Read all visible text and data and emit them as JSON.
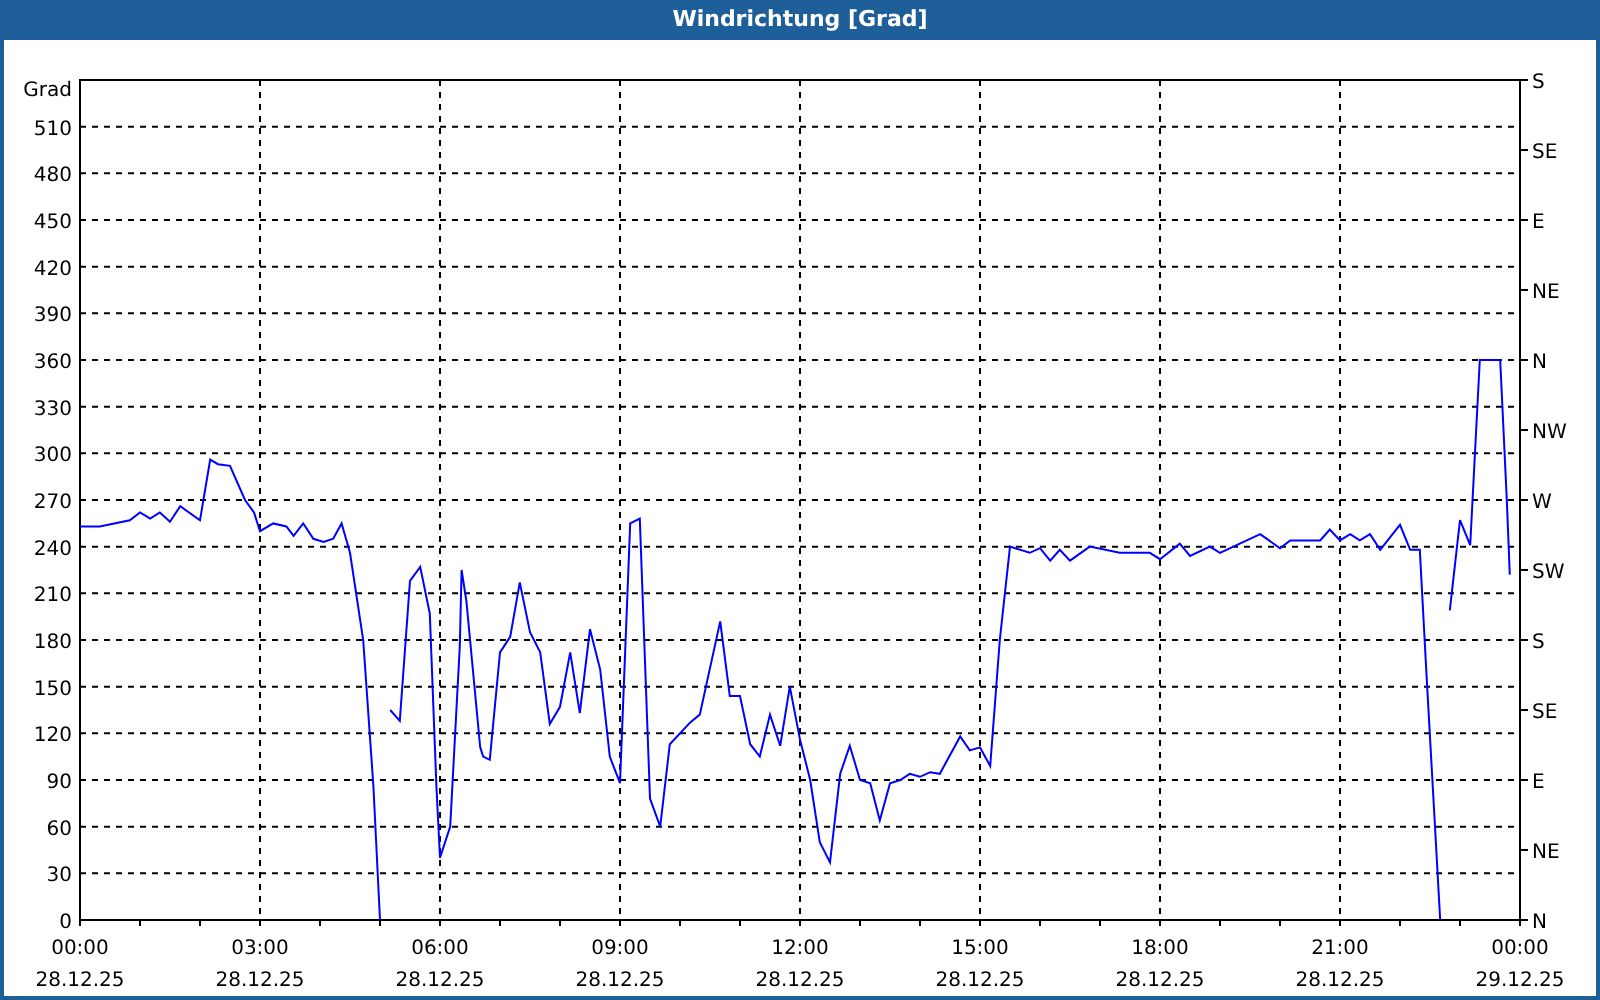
{
  "window": {
    "title": "Windrichtung [Grad]"
  },
  "chart_data": {
    "type": "line",
    "ylabel": "Grad",
    "xlim": [
      0,
      24
    ],
    "ylim": [
      0,
      540
    ],
    "grid": true,
    "x": [
      0,
      0.33,
      0.83,
      1.0,
      1.17,
      1.33,
      1.5,
      1.67,
      2.0,
      2.17,
      2.3,
      2.5,
      2.75,
      2.9,
      3.0,
      3.22,
      3.44,
      3.56,
      3.72,
      3.89,
      4.06,
      4.22,
      4.36,
      4.5,
      4.72,
      4.89,
      5.0,
      5.17,
      5.33,
      5.5,
      5.67,
      5.83,
      5.94,
      6.0,
      6.17,
      6.33,
      6.36,
      6.44,
      6.67,
      6.72,
      6.83,
      7.0,
      7.17,
      7.33,
      7.5,
      7.67,
      7.83,
      8.0,
      8.17,
      8.33,
      8.5,
      8.67,
      8.83,
      9.0,
      9.17,
      9.33,
      9.5,
      9.67,
      9.83,
      10.17,
      10.33,
      10.67,
      10.83,
      11.0,
      11.17,
      11.33,
      11.5,
      11.67,
      11.83,
      12.0,
      12.17,
      12.33,
      12.5,
      12.67,
      12.83,
      13.0,
      13.17,
      13.33,
      13.5,
      13.67,
      13.83,
      14.0,
      14.17,
      14.33,
      14.67,
      14.83,
      15.0,
      15.17,
      15.33,
      15.5,
      15.83,
      16.0,
      16.17,
      16.33,
      16.5,
      16.83,
      17.33,
      17.83,
      18.0,
      18.33,
      18.5,
      18.83,
      19.0,
      19.33,
      19.67,
      20.0,
      20.17,
      20.67,
      20.83,
      21.0,
      21.17,
      21.33,
      21.5,
      21.67,
      22.0,
      22.17,
      22.33,
      22.44,
      22.67,
      22.83,
      23.0,
      23.17,
      23.33,
      23.67,
      23.78,
      23.83
    ],
    "series": [
      {
        "color": "#0000ff",
        "values": [
          253,
          253,
          257,
          262,
          258,
          262,
          256,
          266,
          257,
          296,
          293,
          292,
          270,
          262,
          250,
          255,
          253,
          247,
          255,
          245,
          243,
          245,
          255,
          236,
          180,
          86,
          0,
          null,
          null,
          null,
          null,
          null,
          null,
          null,
          null,
          null,
          null,
          null,
          null,
          null,
          null,
          null,
          null,
          null,
          null,
          null,
          null,
          null,
          null,
          null,
          null,
          null,
          null,
          null,
          null,
          null,
          null,
          null,
          null,
          null,
          null,
          null,
          null,
          null,
          null,
          null,
          null,
          null,
          null,
          null,
          null,
          null,
          null,
          null,
          null,
          null,
          null,
          null,
          null,
          null,
          null,
          null,
          null,
          null,
          null,
          null,
          null,
          null,
          null,
          null,
          null,
          null,
          null,
          null,
          null,
          null,
          null,
          null,
          null,
          null,
          null,
          null,
          null,
          null,
          null,
          null,
          null,
          null,
          null,
          null,
          null,
          null,
          null,
          null,
          null,
          null,
          null,
          null,
          null,
          null,
          null,
          null,
          null,
          null,
          null,
          null
        ]
      },
      {
        "color": "#0000ff",
        "values": [
          null,
          null,
          null,
          null,
          null,
          null,
          null,
          null,
          null,
          null,
          null,
          null,
          null,
          null,
          null,
          null,
          null,
          null,
          null,
          null,
          null,
          null,
          null,
          null,
          null,
          null,
          null,
          135,
          128,
          218,
          227,
          197,
          86,
          40,
          60,
          176,
          225,
          205,
          111,
          105,
          103,
          172,
          182,
          217,
          185,
          172,
          126,
          137,
          172,
          133,
          187,
          161,
          105,
          88,
          255,
          258,
          78,
          60,
          113,
          127,
          132,
          192,
          144,
          144,
          113,
          105,
          132,
          112,
          150,
          116,
          90,
          50,
          37,
          94,
          112,
          90,
          88,
          64,
          88,
          90,
          94,
          92,
          95,
          94,
          118,
          109,
          111,
          99,
          180,
          240,
          236,
          239,
          231,
          238,
          231,
          240,
          236,
          236,
          232,
          242,
          234,
          240,
          236,
          242,
          248,
          239,
          244,
          244,
          251,
          244,
          248,
          244,
          248,
          238,
          254,
          238,
          238,
          159,
          0,
          null,
          null,
          null,
          null,
          null,
          null,
          null
        ]
      },
      {
        "color": "#0000ff",
        "values": [
          null,
          null,
          null,
          null,
          null,
          null,
          null,
          null,
          null,
          null,
          null,
          null,
          null,
          null,
          null,
          null,
          null,
          null,
          null,
          null,
          null,
          null,
          null,
          null,
          null,
          null,
          null,
          null,
          null,
          null,
          null,
          null,
          null,
          null,
          null,
          null,
          null,
          null,
          null,
          null,
          null,
          null,
          null,
          null,
          null,
          null,
          null,
          null,
          null,
          null,
          null,
          null,
          null,
          null,
          null,
          null,
          null,
          null,
          null,
          null,
          null,
          null,
          null,
          null,
          null,
          null,
          null,
          null,
          null,
          null,
          null,
          null,
          null,
          null,
          null,
          null,
          null,
          null,
          null,
          null,
          null,
          null,
          null,
          null,
          null,
          null,
          null,
          null,
          null,
          null,
          null,
          null,
          null,
          null,
          null,
          null,
          null,
          null,
          null,
          null,
          null,
          null,
          null,
          null,
          null,
          null,
          null,
          null,
          null,
          null,
          null,
          null,
          null,
          null,
          null,
          null,
          null,
          null,
          null,
          199,
          257,
          241,
          360,
          360,
          270,
          222
        ]
      }
    ],
    "xticks": [
      {
        "value": 0,
        "label": "00:00"
      },
      {
        "value": 3,
        "label": "03:00"
      },
      {
        "value": 6,
        "label": "06:00"
      },
      {
        "value": 9,
        "label": "09:00"
      },
      {
        "value": 12,
        "label": "12:00"
      },
      {
        "value": 15,
        "label": "15:00"
      },
      {
        "value": 18,
        "label": "18:00"
      },
      {
        "value": 21,
        "label": "21:00"
      },
      {
        "value": 24,
        "label": "00:00"
      }
    ],
    "yticks": [
      0,
      30,
      60,
      90,
      120,
      150,
      180,
      210,
      240,
      270,
      300,
      330,
      360,
      390,
      420,
      450,
      480,
      510
    ]
  },
  "x_axis_dates": [
    "28.12.25",
    "28.12.25",
    "28.12.25",
    "28.12.25",
    "28.12.25",
    "28.12.25",
    "28.12.25",
    "28.12.25",
    "29.12.25"
  ],
  "right_axis": [
    "S",
    "SE",
    "E",
    "NE",
    "N",
    "NW",
    "W",
    "SW",
    "S",
    "SE",
    "E",
    "NE",
    "N"
  ]
}
